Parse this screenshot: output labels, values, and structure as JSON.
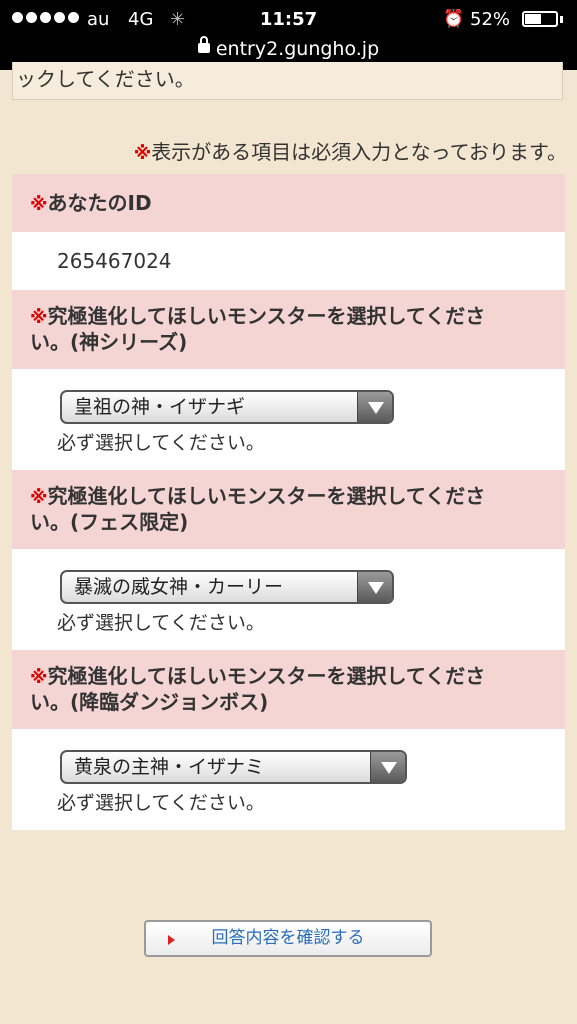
{
  "status_bar": {
    "carrier": "au",
    "network": "4G",
    "time": "11:57",
    "battery_text": "52%",
    "battery_level": 0.52,
    "url": "entry2.gungho.jp"
  },
  "form": {
    "prev_text": "ックしてください。",
    "required_mark": "※",
    "required_note": "表示がある項目は必須入力となっております。",
    "id_section": {
      "label": "あなたのID",
      "value": "265467024"
    },
    "selections": [
      {
        "label_line1": "究極進化してほしいモンスターを選択してくださ",
        "label_line2": "い。(神シリーズ)",
        "selected": "皇祖の神・イザナギ",
        "hint": "必ず選択してください。"
      },
      {
        "label_line1": "究極進化してほしいモンスターを選択してくださ",
        "label_line2": "い。(フェス限定)",
        "selected": "暴滅の威女神・カーリー",
        "hint": "必ず選択してください。"
      },
      {
        "label_line1": "究極進化してほしいモンスターを選択してくださ",
        "label_line2": "い。(降臨ダンジョンボス)",
        "selected": "黄泉の主神・イザナミ",
        "hint": "必ず選択してください。"
      }
    ],
    "confirm_button": "回答内容を確認する"
  },
  "icons": {
    "lock": "lock-icon",
    "alarm": "alarm-clock-icon",
    "spinner": "activity-spinner-icon",
    "dropdown": "dropdown-arrow-icon",
    "button_arrow": "red-arrow-icon"
  }
}
